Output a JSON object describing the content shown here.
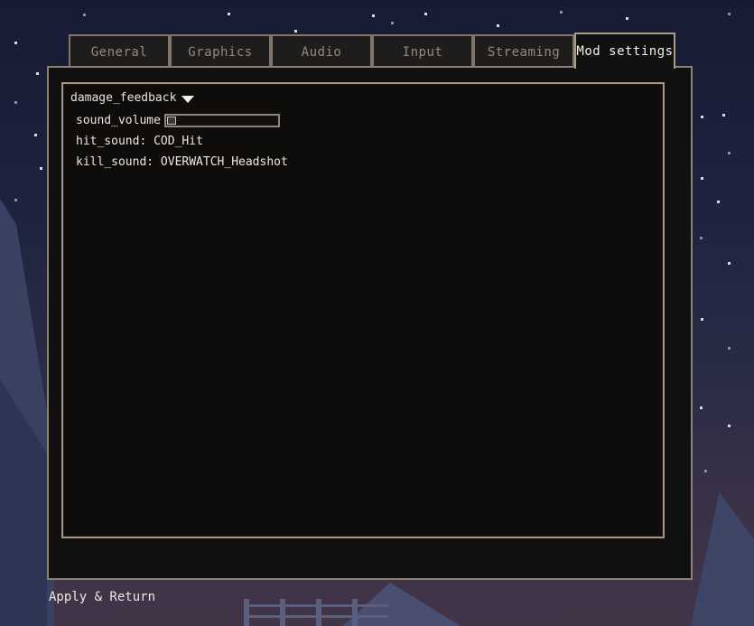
{
  "tabs": [
    {
      "label": "General",
      "active": false
    },
    {
      "label": "Graphics",
      "active": false
    },
    {
      "label": "Audio",
      "active": false
    },
    {
      "label": "Input",
      "active": false
    },
    {
      "label": "Streaming",
      "active": false
    },
    {
      "label": "Mod settings",
      "active": true
    }
  ],
  "mod": {
    "group_label": "damage_feedback",
    "caret_icon": "caret-down-icon",
    "settings": {
      "sound_volume": {
        "label": "sound_volume",
        "value_fraction": 0.0
      },
      "hit_sound": {
        "label": "hit_sound:",
        "value": "COD_Hit"
      },
      "kill_sound": {
        "label": "kill_sound:",
        "value": "OVERWATCH_Headshot"
      }
    }
  },
  "footer": {
    "apply_label": "Apply & Return"
  },
  "colors": {
    "panel_bg": "#111010",
    "panel_border": "#a39780",
    "text": "#ebe7de",
    "tab_inactive_text": "#8f8b84"
  }
}
